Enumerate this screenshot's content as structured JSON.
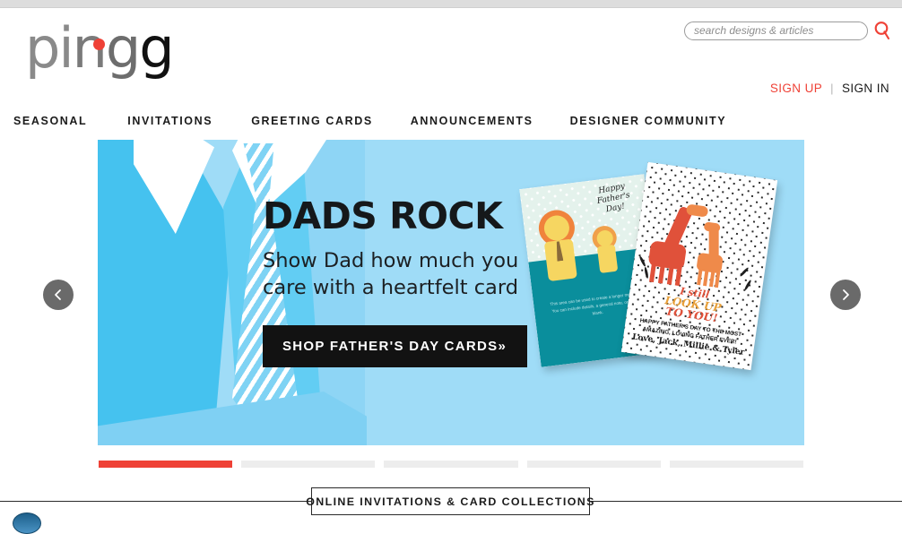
{
  "brand": {
    "logo_text": "pingg",
    "logo_letters": [
      "p",
      "i",
      "n",
      "g",
      "g"
    ],
    "accent_color": "#ef4136",
    "dot_color": "#ef4136"
  },
  "search": {
    "placeholder": "search designs & articles",
    "value": "",
    "icon": "search-icon"
  },
  "account": {
    "sign_up_label": "SIGN UP",
    "separator": "|",
    "sign_in_label": "SIGN IN"
  },
  "nav": {
    "items": [
      {
        "label": "SEASONAL"
      },
      {
        "label": "INVITATIONS"
      },
      {
        "label": "GREETING CARDS"
      },
      {
        "label": "ANNOUNCEMENTS"
      },
      {
        "label": "DESIGNER COMMUNITY"
      }
    ]
  },
  "hero": {
    "title": "DADS ROCK",
    "subtitle": "Show Dad how much you care with a heartfelt card",
    "cta_label": "SHOP FATHER'S DAY CARDS»",
    "background_color": "#8ed5f5",
    "prev_icon": "chevron-left-icon",
    "next_icon": "chevron-right-icon",
    "cards": {
      "lion_card": {
        "greeting": "Happy Father's Day!",
        "body_text": "This area can be used to create a longer message. You can include details, a general note, or leave it blank.",
        "top_color": "#e4f2ec",
        "bottom_color": "#0a8e9c"
      },
      "giraffe_card": {
        "headline_line1": "I still",
        "headline_line2": "LOOK UP",
        "headline_line3": "TO YOU!",
        "subtext": "HAPPY FATHER'S DAY TO THE MOST AMAZING, LOVING FATHER EVER!",
        "names": "Love, Jack, Millie & Tyler"
      }
    },
    "indicators": [
      {
        "active": true
      },
      {
        "active": false
      },
      {
        "active": false
      },
      {
        "active": false
      },
      {
        "active": false
      }
    ],
    "active_indicator_color": "#ef4136",
    "inactive_indicator_color": "#ededed"
  },
  "section": {
    "title": "ONLINE INVITATIONS & CARD COLLECTIONS"
  }
}
